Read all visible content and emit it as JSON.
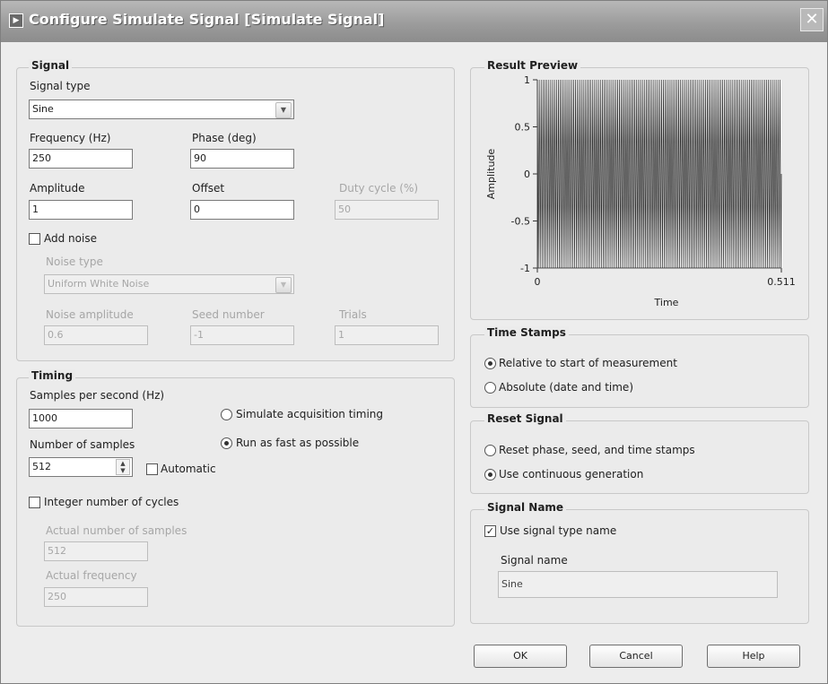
{
  "window": {
    "title": "Configure Simulate Signal [Simulate Signal]",
    "close_glyph": "✕"
  },
  "signal": {
    "legend": "Signal",
    "signal_type_label": "Signal type",
    "signal_type_value": "Sine",
    "frequency_label": "Frequency (Hz)",
    "frequency_value": "250",
    "phase_label": "Phase (deg)",
    "phase_value": "90",
    "amplitude_label": "Amplitude",
    "amplitude_value": "1",
    "offset_label": "Offset",
    "offset_value": "0",
    "duty_cycle_label": "Duty cycle (%)",
    "duty_cycle_value": "50",
    "add_noise_label": "Add noise",
    "add_noise_checked": false,
    "noise_type_label": "Noise type",
    "noise_type_value": "Uniform White Noise",
    "noise_amplitude_label": "Noise amplitude",
    "noise_amplitude_value": "0.6",
    "seed_number_label": "Seed number",
    "seed_number_value": "-1",
    "trials_label": "Trials",
    "trials_value": "1"
  },
  "timing": {
    "legend": "Timing",
    "samples_per_second_label": "Samples per second (Hz)",
    "samples_per_second_value": "1000",
    "number_of_samples_label": "Number of samples",
    "number_of_samples_value": "512",
    "automatic_label": "Automatic",
    "simulate_acquisition_label": "Simulate acquisition timing",
    "run_fast_label": "Run as fast as possible",
    "timing_mode_selected": "run_fast",
    "integer_cycles_label": "Integer number of cycles",
    "actual_samples_label": "Actual number of samples",
    "actual_samples_value": "512",
    "actual_frequency_label": "Actual frequency",
    "actual_frequency_value": "250"
  },
  "preview": {
    "legend": "Result Preview",
    "chart_data": {
      "type": "line",
      "title": "",
      "xlabel": "Time",
      "ylabel": "Amplitude",
      "xlim": [
        0,
        0.511
      ],
      "ylim": [
        -1,
        1
      ],
      "x_tick_labels": [
        "0",
        "0.511"
      ],
      "y_tick_labels": [
        "1",
        "0.5",
        "0",
        "-0.5",
        "-1"
      ],
      "y_ticks": [
        1,
        0.5,
        0,
        -0.5,
        -1
      ],
      "sample_rate_hz": 1000,
      "samples": 512,
      "series": [
        {
          "frequency_hz": 250,
          "phase_deg": 90,
          "amplitude": 1,
          "offset": 0,
          "note_values": "cos-like sequence 1,0,-1,0 repeating"
        }
      ],
      "grid": false,
      "line_color": "#202020"
    }
  },
  "time_stamps": {
    "legend": "Time Stamps",
    "relative_label": "Relative to start of measurement",
    "absolute_label": "Absolute (date and time)",
    "selected": "relative"
  },
  "reset_signal": {
    "legend": "Reset Signal",
    "reset_label": "Reset phase, seed, and time stamps",
    "continuous_label": "Use continuous generation",
    "selected": "continuous"
  },
  "signal_name": {
    "legend": "Signal Name",
    "use_type_name_label": "Use signal type name",
    "use_type_name_checked": true,
    "name_label": "Signal name",
    "name_value": "Sine"
  },
  "buttons": {
    "ok": "OK",
    "cancel": "Cancel",
    "help": "Help"
  }
}
